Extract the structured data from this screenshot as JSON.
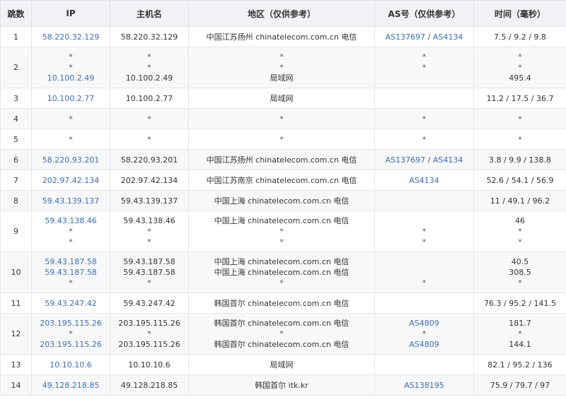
{
  "headers": {
    "hop": "跳数",
    "ip": "IP",
    "host": "主机名",
    "region": "地区（仅供参考）",
    "as": "AS号（仅供参考）",
    "time": "时间（毫秒）"
  },
  "rows": [
    {
      "hop": "1",
      "ip": [
        "58.220.32.129"
      ],
      "host": [
        "58.220.32.129"
      ],
      "region": [
        "中国江苏扬州 chinatelecom.com.cn 电信"
      ],
      "as": [
        "AS137697 / AS4134"
      ],
      "time": [
        "7.5 / 9.2 / 9.8"
      ]
    },
    {
      "hop": "2",
      "ip": [
        "*",
        "*",
        "10.100.2.49"
      ],
      "host": [
        "*",
        "*",
        "10.100.2.49"
      ],
      "region": [
        "*",
        "*",
        "局域网"
      ],
      "as": [
        "*",
        "*",
        ""
      ],
      "time": [
        "*",
        "*",
        "495.4"
      ]
    },
    {
      "hop": "3",
      "ip": [
        "10.100.2.77"
      ],
      "host": [
        "10.100.2.77"
      ],
      "region": [
        "局域网"
      ],
      "as": [
        ""
      ],
      "time": [
        "11.2 / 17.5 / 36.7"
      ]
    },
    {
      "hop": "4",
      "ip": [
        "*"
      ],
      "host": [
        "*"
      ],
      "region": [
        "*"
      ],
      "as": [
        "*"
      ],
      "time": [
        "*"
      ]
    },
    {
      "hop": "5",
      "ip": [
        "*"
      ],
      "host": [
        "*"
      ],
      "region": [
        "*"
      ],
      "as": [
        "*"
      ],
      "time": [
        "*"
      ]
    },
    {
      "hop": "6",
      "ip": [
        "58.220.93.201"
      ],
      "host": [
        "58.220.93.201"
      ],
      "region": [
        "中国江苏扬州 chinatelecom.com.cn 电信"
      ],
      "as": [
        "AS137697 / AS4134"
      ],
      "time": [
        "3.8 / 9.9 / 138.8"
      ]
    },
    {
      "hop": "7",
      "ip": [
        "202.97.42.134"
      ],
      "host": [
        "202.97.42.134"
      ],
      "region": [
        "中国江苏南京 chinatelecom.com.cn 电信"
      ],
      "as": [
        "AS4134"
      ],
      "time": [
        "52.6 / 54.1 / 56.9"
      ]
    },
    {
      "hop": "8",
      "ip": [
        "59.43.139.137"
      ],
      "host": [
        "59.43.139.137"
      ],
      "region": [
        "中国上海 chinatelecom.com.cn 电信"
      ],
      "as": [
        ""
      ],
      "time": [
        "11 / 49.1 / 96.2"
      ]
    },
    {
      "hop": "9",
      "ip": [
        "59.43.138.46",
        "*",
        "*"
      ],
      "host": [
        "59.43.138.46",
        "*",
        "*"
      ],
      "region": [
        "中国上海 chinatelecom.com.cn 电信",
        "*",
        "*"
      ],
      "as": [
        "",
        "*",
        "*"
      ],
      "time": [
        "46",
        "*",
        "*"
      ]
    },
    {
      "hop": "10",
      "ip": [
        "59.43.187.58",
        "59.43.187.58",
        "*"
      ],
      "host": [
        "59.43.187.58",
        "59.43.187.58",
        "*"
      ],
      "region": [
        "中国上海 chinatelecom.com.cn 电信",
        "中国上海 chinatelecom.com.cn 电信",
        "*"
      ],
      "as": [
        "",
        "",
        "*"
      ],
      "time": [
        "40.5",
        "308.5",
        "*"
      ]
    },
    {
      "hop": "11",
      "ip": [
        "59.43.247.42"
      ],
      "host": [
        "59.43.247.42"
      ],
      "region": [
        "韩国首尔 chinatelecom.com.cn 电信"
      ],
      "as": [
        ""
      ],
      "time": [
        "76.3 / 95.2 / 141.5"
      ]
    },
    {
      "hop": "12",
      "ip": [
        "203.195.115.26",
        "*",
        "203.195.115.26"
      ],
      "host": [
        "203.195.115.26",
        "*",
        "203.195.115.26"
      ],
      "region": [
        "韩国首尔 chinatelecom.com.cn 电信",
        "*",
        "韩国首尔 chinatelecom.com.cn 电信"
      ],
      "as": [
        "AS4809",
        "*",
        "AS4809"
      ],
      "time": [
        "181.7",
        "*",
        "144.1"
      ]
    },
    {
      "hop": "13",
      "ip": [
        "10.10.10.6"
      ],
      "host": [
        "10.10.10.6"
      ],
      "region": [
        "局域网"
      ],
      "as": [
        ""
      ],
      "time": [
        "82.1 / 95.2 / 136"
      ]
    },
    {
      "hop": "14",
      "ip": [
        "49.128.218.85"
      ],
      "host": [
        "49.128.218.85"
      ],
      "region": [
        "韩国首尔 itk.kr"
      ],
      "as": [
        "AS138195"
      ],
      "time": [
        "75.9 / 79.7 / 97"
      ]
    }
  ]
}
